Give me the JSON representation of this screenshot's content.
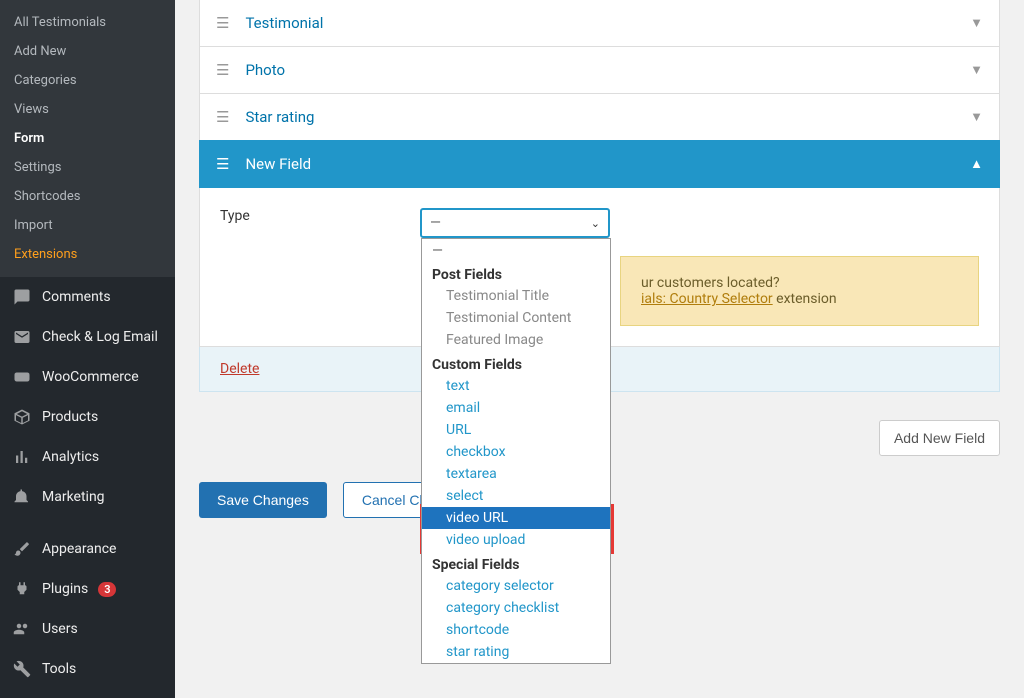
{
  "sidebar": {
    "subitems": [
      {
        "label": "All Testimonials"
      },
      {
        "label": "Add New"
      },
      {
        "label": "Categories"
      },
      {
        "label": "Views"
      },
      {
        "label": "Form",
        "active": true
      },
      {
        "label": "Settings"
      },
      {
        "label": "Shortcodes"
      },
      {
        "label": "Import"
      },
      {
        "label": "Extensions",
        "highlight": true
      }
    ],
    "menu": [
      {
        "icon": "comment",
        "label": "Comments"
      },
      {
        "icon": "mail",
        "label": "Check & Log Email"
      },
      {
        "icon": "woo",
        "label": "WooCommerce"
      },
      {
        "icon": "box",
        "label": "Products"
      },
      {
        "icon": "chart",
        "label": "Analytics"
      },
      {
        "icon": "megaphone",
        "label": "Marketing"
      },
      {
        "icon": "brush",
        "label": "Appearance",
        "sep_before": true
      },
      {
        "icon": "plug",
        "label": "Plugins",
        "badge": "3"
      },
      {
        "icon": "users",
        "label": "Users"
      },
      {
        "icon": "wrench",
        "label": "Tools"
      }
    ]
  },
  "accordions": [
    {
      "title": "Testimonial"
    },
    {
      "title": "Photo"
    },
    {
      "title": "Star rating"
    }
  ],
  "newfield": {
    "title": "New Field"
  },
  "panel": {
    "typeLabel": "Type",
    "selectDisplay": "—",
    "deleteLabel": "Delete"
  },
  "dropdown": {
    "dash": "—",
    "groups": [
      {
        "label": "Post Fields",
        "opts": [
          {
            "t": "Testimonial Title",
            "disabled": true
          },
          {
            "t": "Testimonial Content",
            "disabled": true
          },
          {
            "t": "Featured Image",
            "disabled": true
          }
        ]
      },
      {
        "label": "Custom Fields",
        "opts": [
          {
            "t": "text"
          },
          {
            "t": "email"
          },
          {
            "t": "URL"
          },
          {
            "t": "checkbox"
          },
          {
            "t": "textarea"
          },
          {
            "t": "select"
          },
          {
            "t": "video URL",
            "hl": true
          },
          {
            "t": "video upload"
          }
        ]
      },
      {
        "label": "Special Fields",
        "opts": [
          {
            "t": "category selector"
          },
          {
            "t": "category checklist"
          },
          {
            "t": "shortcode"
          },
          {
            "t": "star rating"
          }
        ]
      }
    ]
  },
  "notice": {
    "line1_before": "ur customers located?",
    "link": "ials: Country Selector",
    "line2_after": " extension"
  },
  "buttons": {
    "save": "Save Changes",
    "cancel": "Cancel Chan",
    "addnew": "Add New Field"
  }
}
